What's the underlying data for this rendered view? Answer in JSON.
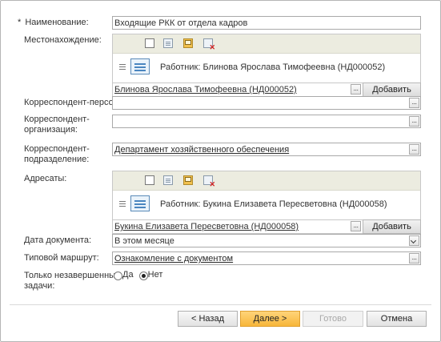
{
  "form": {
    "name": {
      "label": "Наименование:",
      "required_mark": "*",
      "value": "Входящие РКК от отдела кадров"
    },
    "location": {
      "label": "Местонахождение:",
      "row_text": "Работник: Блинова Ярослава Тимофеевна (НД000052)",
      "selected_value": "Блинова Ярослава Тимофеевна (НД000052)",
      "add_label": "Добавить",
      "pick_glyph": "..."
    },
    "correspondent_person": {
      "label": "Корреспондент-персона:",
      "value": "",
      "pick_glyph": "..."
    },
    "correspondent_org": {
      "label_line1": "Корреспондент-",
      "label_line2": "организация:",
      "value": "",
      "pick_glyph": "..."
    },
    "correspondent_dept": {
      "label_line1": "Корреспондент-",
      "label_line2": "подразделение:",
      "value": "Департамент хозяйственного обеспечения",
      "pick_glyph": "..."
    },
    "addressees": {
      "label": "Адресаты:",
      "row_text": "Работник: Букина Елизавета Пересветовна (НД000058)",
      "selected_value": "Букина Елизавета Пересветовна (НД000058)",
      "add_label": "Добавить",
      "pick_glyph": "..."
    },
    "doc_date": {
      "label": "Дата документа:",
      "value": "В этом месяце"
    },
    "route": {
      "label": "Типовой маршрут:",
      "value": "Ознакомление с документом",
      "pick_glyph": "..."
    },
    "unfinished": {
      "label_line1": "Только незавершенные",
      "label_line2": "задачи:",
      "options": [
        "Да",
        "Нет"
      ],
      "selected": "Нет"
    }
  },
  "footer": {
    "back_label": "< Назад",
    "next_label": "Далее >",
    "done_label": "Готово",
    "cancel_label": "Отмена"
  },
  "toolbar_icons": [
    "checkbox-icon",
    "table-icon",
    "mail-icon",
    "delete-icon"
  ],
  "colors": {
    "accent_button": "#f7b63a",
    "panel_toolbar": "#ecece0",
    "doc_icon": "#4a86c0",
    "delete_mark": "#d02020"
  }
}
